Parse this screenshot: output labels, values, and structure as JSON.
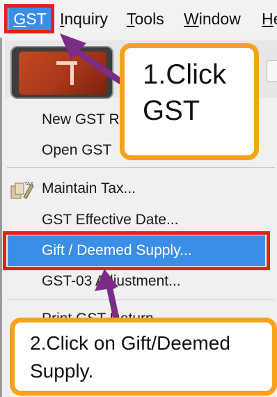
{
  "menubar": {
    "items": [
      {
        "label": "GST",
        "underline": "G",
        "rest": "ST"
      },
      {
        "label": "Inquiry",
        "underline": "I",
        "rest": "nquiry"
      },
      {
        "label": "Tools",
        "underline": "T",
        "rest": "ools"
      },
      {
        "label": "Window",
        "underline": "W",
        "rest": "indow"
      },
      {
        "label": "He",
        "underline": "H",
        "rest": "e"
      }
    ]
  },
  "dropdown": {
    "items": [
      {
        "label": "New GST R"
      },
      {
        "label": "Open GST"
      },
      {
        "label": "Maintain Tax..."
      },
      {
        "label": "GST Effective Date..."
      },
      {
        "label": "Gift / Deemed Supply..."
      },
      {
        "label": "GST-03 Adjustment..."
      },
      {
        "label": "Print GST Return..."
      }
    ]
  },
  "callouts": {
    "step1": {
      "line1": "1.Click",
      "line2": "GST"
    },
    "step2": {
      "line1": "2.Click on Gift/Deemed",
      "line2": "Supply."
    }
  },
  "colors": {
    "highlight": "#3a8ee6",
    "outline_red": "#e2231a",
    "callout_orange": "#f7a21a",
    "arrow_purple": "#7b2c87"
  }
}
